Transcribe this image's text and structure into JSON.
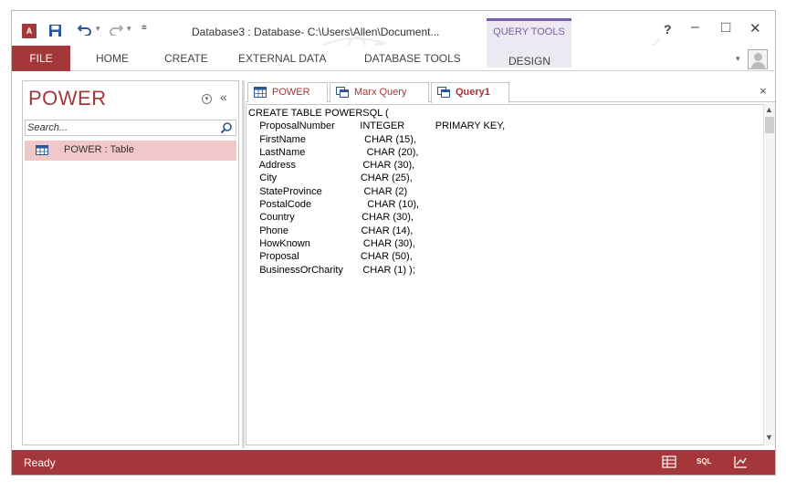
{
  "titlebar": {
    "app_icon_text": "A",
    "title": "Database3 : Database- C:\\Users\\Allen\\Document...",
    "context_group": "QUERY TOOLS",
    "help": "?",
    "minimize": "–",
    "maximize": "□",
    "close": "✕"
  },
  "ribbon": {
    "tabs": [
      {
        "label": "FILE"
      },
      {
        "label": "HOME"
      },
      {
        "label": "CREATE"
      },
      {
        "label": "EXTERNAL DATA"
      },
      {
        "label": "DATABASE TOOLS"
      },
      {
        "label": "DESIGN"
      }
    ]
  },
  "navpane": {
    "title": "POWER",
    "collapse": "«",
    "search_placeholder": "Search...",
    "items": [
      {
        "label": "POWER : Table",
        "icon": "table-icon"
      }
    ]
  },
  "documents": {
    "tabs": [
      {
        "label": "POWER",
        "icon": "table-icon",
        "active": false
      },
      {
        "label": "Marx Query",
        "icon": "query-icon",
        "active": false
      },
      {
        "label": "Query1",
        "icon": "query-icon",
        "active": true
      }
    ],
    "close": "×"
  },
  "sql": {
    "text": "CREATE TABLE POWERSQL (\n    ProposalNumber         INTEGER           PRIMARY KEY,\n    FirstName                     CHAR (15),\n    LastName                      CHAR (20),\n    Address                        CHAR (30),\n    City                              CHAR (25),\n    StateProvince               CHAR (2)\n    PostalCode                    CHAR (10),\n    Country                        CHAR (30),\n    Phone                          CHAR (14),\n    HowKnown                   CHAR (30),\n    Proposal                      CHAR (50),\n    BusinessOrCharity       CHAR (1) );"
  },
  "statusbar": {
    "status": "Ready",
    "sql_view_label": "SQL"
  },
  "colors": {
    "accent": "#a4373a",
    "nav_selected": "#f0c8c9",
    "context_tab": "#7a5da8"
  }
}
